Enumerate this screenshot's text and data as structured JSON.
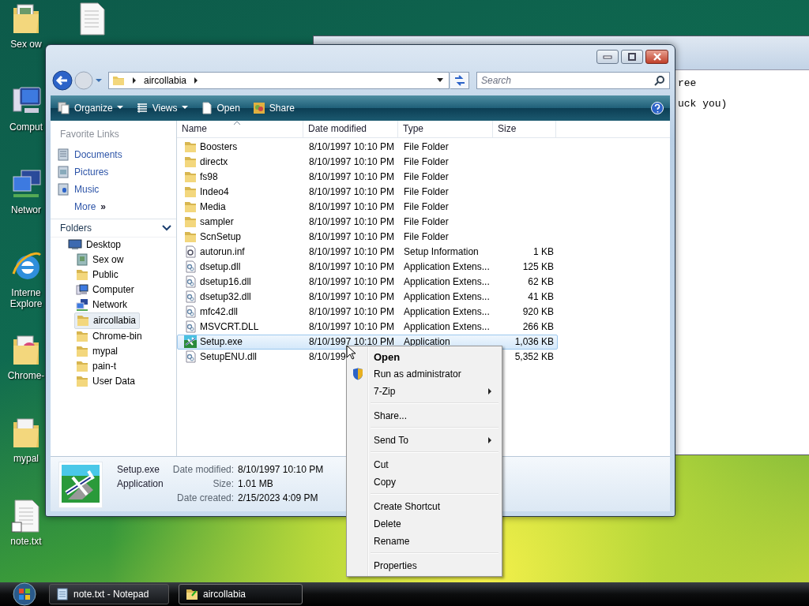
{
  "desktop_icons": [
    {
      "label": "Sex ow",
      "kind": "folder-doc"
    },
    {
      "label": "Comput",
      "kind": "computer"
    },
    {
      "label": "Networ",
      "kind": "network"
    },
    {
      "label": "Interne Explore",
      "kind": "browser"
    },
    {
      "label": "Chrome-",
      "kind": "chrome-folder"
    },
    {
      "label": "mypal",
      "kind": "folder"
    },
    {
      "label": "note.txt",
      "kind": "text-shortcut"
    },
    {
      "kind": "text-file"
    }
  ],
  "notepad_window": {
    "lines": [
      "ree",
      "uck you)"
    ]
  },
  "explorer": {
    "address": {
      "crumbs": [
        "aircollabia"
      ]
    },
    "search": {
      "placeholder": "Search"
    },
    "toolbar": [
      {
        "label": "Organize",
        "kind": "organize",
        "dropdown": true
      },
      {
        "label": "Views",
        "kind": "views",
        "dropdown": true
      },
      {
        "label": "Open",
        "kind": "open",
        "dropdown": false
      },
      {
        "label": "Share",
        "kind": "share",
        "dropdown": false
      }
    ],
    "favorite_links": {
      "title": "Favorite Links",
      "items": [
        {
          "label": "Documents",
          "kind": "documents"
        },
        {
          "label": "Pictures",
          "kind": "pictures"
        },
        {
          "label": "Music",
          "kind": "music"
        },
        {
          "label": "More",
          "kind": "more",
          "glyph": "»"
        }
      ]
    },
    "folders": {
      "title": "Folders",
      "tree": [
        {
          "label": "Desktop",
          "kind": "desktop",
          "selected": false,
          "children": [
            {
              "label": "Sex ow",
              "kind": "folder-doc",
              "selected": false
            },
            {
              "label": "Public",
              "kind": "folder",
              "selected": false
            },
            {
              "label": "Computer",
              "kind": "computer",
              "selected": false
            },
            {
              "label": "Network",
              "kind": "network",
              "selected": false
            },
            {
              "label": "aircollabia",
              "kind": "folder",
              "selected": true
            },
            {
              "label": "Chrome-bin",
              "kind": "folder",
              "selected": false
            },
            {
              "label": "mypal",
              "kind": "folder",
              "selected": false
            },
            {
              "label": "pain-t",
              "kind": "folder",
              "selected": false
            },
            {
              "label": "User Data",
              "kind": "folder",
              "selected": false
            }
          ]
        }
      ]
    },
    "columns": [
      {
        "label": "Name",
        "sorted": true
      },
      {
        "label": "Date modified",
        "sorted": false
      },
      {
        "label": "Type",
        "sorted": false
      },
      {
        "label": "Size",
        "sorted": false
      }
    ],
    "files": [
      {
        "name": "Boosters",
        "date": "8/10/1997 10:10 PM",
        "type": "File Folder",
        "kind": "folder",
        "selected": false
      },
      {
        "name": "directx",
        "date": "8/10/1997 10:10 PM",
        "type": "File Folder",
        "kind": "folder",
        "selected": false
      },
      {
        "name": "fs98",
        "date": "8/10/1997 10:10 PM",
        "type": "File Folder",
        "kind": "folder",
        "selected": false
      },
      {
        "name": "Indeo4",
        "date": "8/10/1997 10:10 PM",
        "type": "File Folder",
        "kind": "folder",
        "selected": false
      },
      {
        "name": "Media",
        "date": "8/10/1997 10:10 PM",
        "type": "File Folder",
        "kind": "folder",
        "selected": false
      },
      {
        "name": "sampler",
        "date": "8/10/1997 10:10 PM",
        "type": "File Folder",
        "kind": "folder",
        "selected": false
      },
      {
        "name": "ScnSetup",
        "date": "8/10/1997 10:10 PM",
        "type": "File Folder",
        "kind": "folder",
        "selected": false
      },
      {
        "name": "autorun.inf",
        "date": "8/10/1997 10:10 PM",
        "type": "Setup Information",
        "size": "1 KB",
        "kind": "inf",
        "selected": false
      },
      {
        "name": "dsetup.dll",
        "date": "8/10/1997 10:10 PM",
        "type": "Application Extens...",
        "size": "125 KB",
        "kind": "dll",
        "selected": false
      },
      {
        "name": "dsetup16.dll",
        "date": "8/10/1997 10:10 PM",
        "type": "Application Extens...",
        "size": "62 KB",
        "kind": "dll",
        "selected": false
      },
      {
        "name": "dsetup32.dll",
        "date": "8/10/1997 10:10 PM",
        "type": "Application Extens...",
        "size": "41 KB",
        "kind": "dll",
        "selected": false
      },
      {
        "name": "mfc42.dll",
        "date": "8/10/1997 10:10 PM",
        "type": "Application Extens...",
        "size": "920 KB",
        "kind": "dll",
        "selected": false
      },
      {
        "name": "MSVCRT.DLL",
        "date": "8/10/1997 10:10 PM",
        "type": "Application Extens...",
        "size": "266 KB",
        "kind": "dll",
        "selected": false
      },
      {
        "name": "Setup.exe",
        "date": "8/10/1997 10:10 PM",
        "type": "Application",
        "size": "1,036 KB",
        "kind": "exe",
        "selected": true
      },
      {
        "name": "SetupENU.dll",
        "date": "8/10/199",
        "size": "5,352 KB",
        "kind": "dll",
        "selected": false
      }
    ],
    "details": {
      "name": "Setup.exe",
      "type": "Application",
      "properties": [
        {
          "label": "Date modified:",
          "value": "8/10/1997 10:10 PM"
        },
        {
          "label": "Size:",
          "value": "1.01 MB"
        },
        {
          "label": "Date created:",
          "value": "2/15/2023 4:09 PM"
        }
      ]
    }
  },
  "context_menu": {
    "items": [
      {
        "label": "Open",
        "kind": "default"
      },
      {
        "label": "Run as administrator",
        "kind": "shield"
      },
      {
        "label": "7-Zip",
        "kind": "submenu"
      },
      {
        "kind": "separator"
      },
      {
        "label": "Share...",
        "kind": "plain"
      },
      {
        "kind": "separator"
      },
      {
        "label": "Send To",
        "kind": "submenu"
      },
      {
        "kind": "separator"
      },
      {
        "label": "Cut",
        "kind": "plain"
      },
      {
        "label": "Copy",
        "kind": "plain"
      },
      {
        "kind": "separator"
      },
      {
        "label": "Create Shortcut",
        "kind": "plain"
      },
      {
        "label": "Delete",
        "kind": "plain"
      },
      {
        "label": "Rename",
        "kind": "plain"
      },
      {
        "kind": "separator"
      },
      {
        "label": "Properties",
        "kind": "plain"
      }
    ]
  },
  "taskbar": {
    "buttons": [
      {
        "label": "note.txt - Notepad",
        "kind": "notepad",
        "selected": false
      },
      {
        "label": "aircollabia",
        "kind": "folder",
        "selected": true
      }
    ]
  }
}
